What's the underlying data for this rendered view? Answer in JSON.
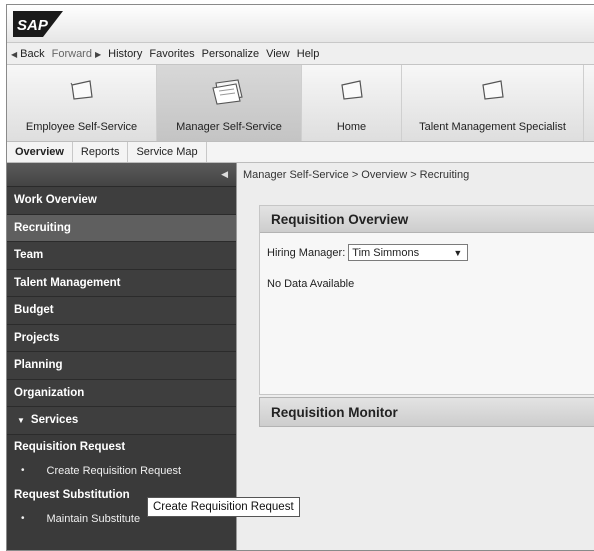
{
  "brand": {
    "logo_text": "SAP"
  },
  "menubar": {
    "back": "Back",
    "forward": "Forward",
    "items": [
      "History",
      "Favorites",
      "Personalize",
      "View",
      "Help"
    ]
  },
  "launchpad": {
    "tabs": [
      {
        "label": "Employee Self-Service",
        "icon": "folder-icon"
      },
      {
        "label": "Manager Self-Service",
        "icon": "documents-icon",
        "selected": true
      },
      {
        "label": "Home",
        "icon": "folder-icon"
      },
      {
        "label": "Talent Management Specialist",
        "icon": "folder-icon"
      }
    ]
  },
  "subtabs": [
    "Overview",
    "Reports",
    "Service Map"
  ],
  "nav": {
    "items": [
      "Work Overview",
      "Recruiting",
      "Team",
      "Talent Management",
      "Budget",
      "Projects",
      "Planning",
      "Organization"
    ],
    "services_label": "Services",
    "groups": [
      {
        "title": "Requisition Request",
        "items": [
          "Create Requisition Request"
        ]
      },
      {
        "title": "Request Substitution",
        "items": [
          "Maintain Substitute"
        ]
      }
    ]
  },
  "tooltip": "Create Requisition Request",
  "breadcrumb": "Manager Self-Service  >  Overview  >  Recruiting",
  "requisition_overview": {
    "title": "Requisition Overview",
    "hiring_manager_label": "Hiring Manager:",
    "hiring_manager_value": "Tim Simmons",
    "no_data": "No Data Available"
  },
  "requisition_monitor": {
    "title": "Requisition Monitor"
  }
}
